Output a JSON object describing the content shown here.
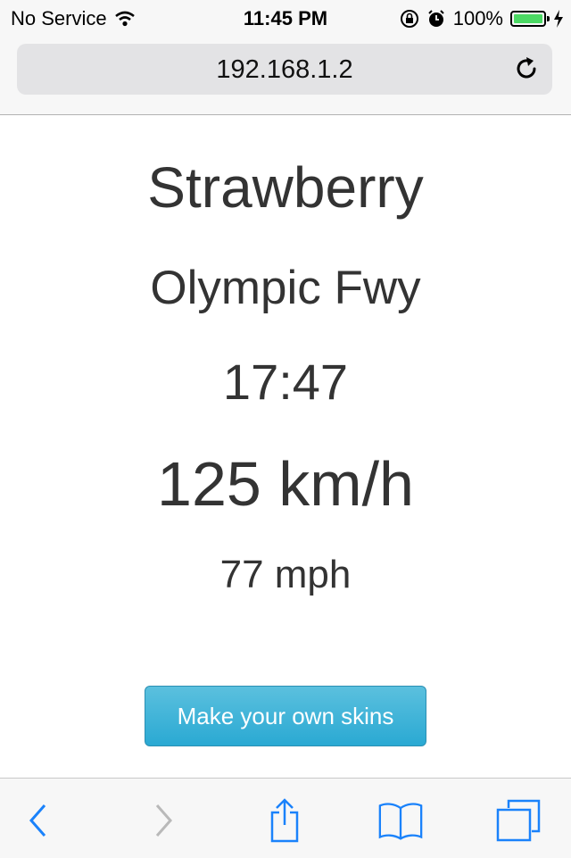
{
  "status": {
    "carrier": "No Service",
    "time": "11:45 PM",
    "battery": "100%",
    "battery_level": 1.0,
    "wifi_icon": "wifi-icon",
    "rotation_lock_icon": "rotation-lock-icon",
    "alarm_icon": "alarm-icon",
    "charging_icon": "charging-bolt-icon"
  },
  "browser": {
    "url": "192.168.1.2",
    "reload_icon": "reload-icon"
  },
  "main": {
    "title": "Strawberry",
    "road": "Olympic Fwy",
    "time": "17:47",
    "speed": "125 km/h",
    "speed_mph": "77 mph",
    "button_label": "Make your own skins"
  },
  "toolbar": {
    "items": [
      "back-icon",
      "forward-icon",
      "share-icon",
      "bookmarks-icon",
      "tabs-icon"
    ]
  },
  "colors": {
    "accent": "#1a82fb",
    "button": "#2aa9d3",
    "battery": "#4cd964",
    "text": "#333333"
  }
}
